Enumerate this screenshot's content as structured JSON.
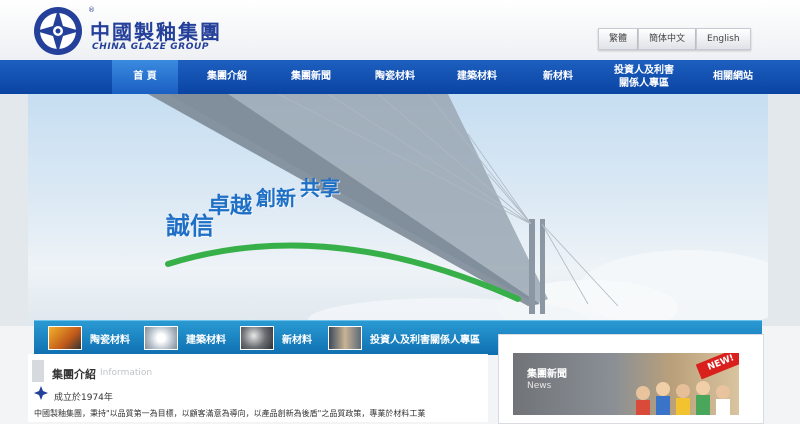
{
  "header": {
    "logo_cn": "中國製釉集團",
    "logo_en": "CHINA GLAZE GROUP",
    "logo_reg": "®",
    "languages": [
      "繁體",
      "簡体中文",
      "English"
    ]
  },
  "nav": {
    "items": [
      {
        "label": "首 頁",
        "active": true
      },
      {
        "label": "集團介紹"
      },
      {
        "label": "集團新聞"
      },
      {
        "label": "陶瓷材料"
      },
      {
        "label": "建築材料"
      },
      {
        "label": "新材料"
      },
      {
        "label": "投資人及利害",
        "label2": "關係人專區"
      },
      {
        "label": "相關網站"
      }
    ]
  },
  "banner": {
    "slogan": [
      "誠信",
      "卓越",
      "創新",
      "共享"
    ]
  },
  "features": [
    {
      "label": "陶瓷材料",
      "icon": "ceramic-thumbnail"
    },
    {
      "label": "建築材料",
      "icon": "building-thumbnail"
    },
    {
      "label": "新材料",
      "icon": "new-material-thumbnail"
    },
    {
      "label": "投資人及利害關係人專區",
      "icon": "investor-thumbnail"
    }
  ],
  "intro": {
    "title": "集團介紹",
    "subtitle": "Information",
    "since": "成立於1974年",
    "text": "中國製釉集團，秉持\"以品質第一為目標，以顧客滿意為導向，以產品創新為後盾\"之品質政策，專業於材料工業"
  },
  "news": {
    "title": "集團新聞",
    "subtitle": "News",
    "tag": "NEW!"
  },
  "colors": {
    "nav": "#0a44a3",
    "feature_bar": "#1a84c4",
    "brand": "#24409a",
    "slogan": "#1e6fc6"
  }
}
